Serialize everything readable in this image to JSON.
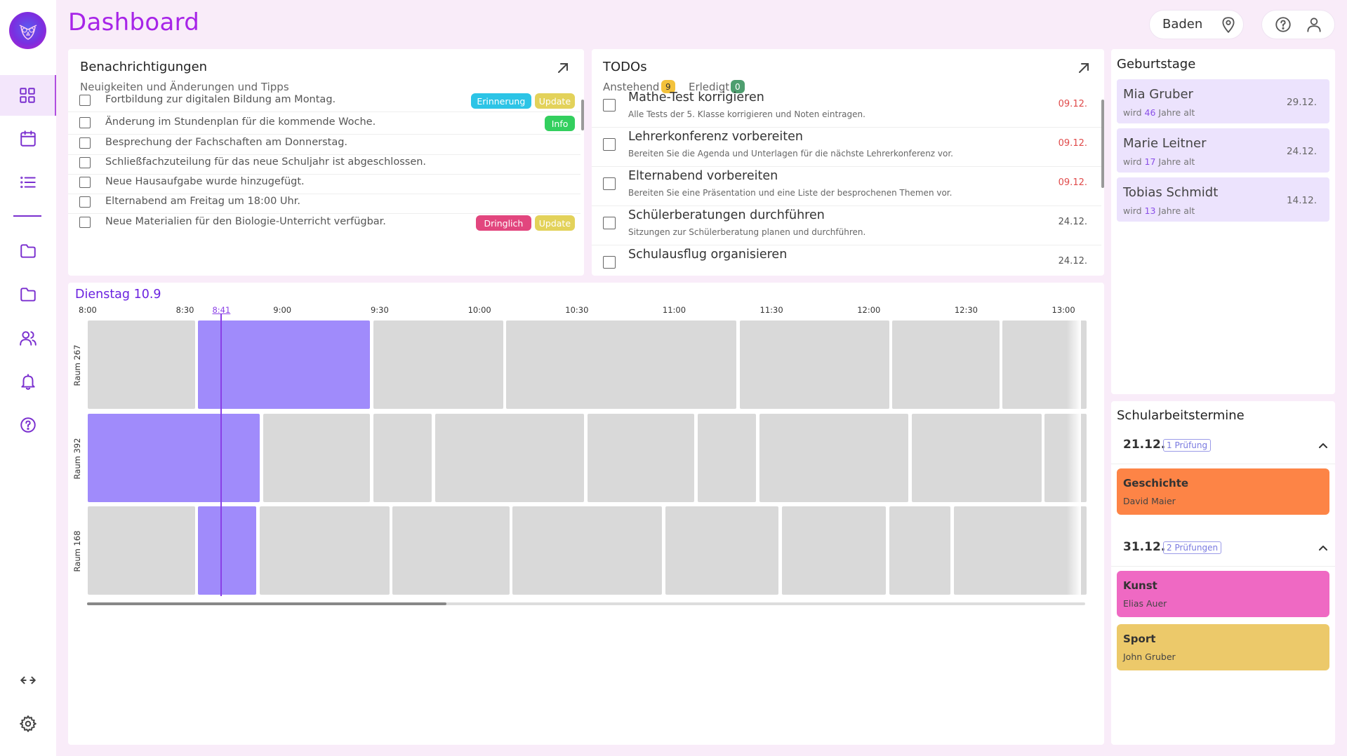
{
  "page": {
    "title": "Dashboard"
  },
  "header": {
    "location": "Baden"
  },
  "colors": {
    "accent": "#a724e8",
    "block_active": "#a08bfb",
    "block_idle": "#d9d9d9",
    "now_line": "#8a3fe6",
    "overdue": "#e04a4a"
  },
  "sidebar": {
    "items": [
      {
        "name": "dashboard",
        "icon": "grid-icon"
      },
      {
        "name": "calendar",
        "icon": "calendar-icon"
      },
      {
        "name": "list",
        "icon": "list-icon"
      },
      {
        "name": "folder-1",
        "icon": "folder-icon"
      },
      {
        "name": "folder-2",
        "icon": "folder-icon"
      },
      {
        "name": "users",
        "icon": "users-icon"
      },
      {
        "name": "notifications",
        "icon": "bell-icon"
      },
      {
        "name": "help",
        "icon": "help-icon"
      },
      {
        "name": "resize",
        "icon": "arrows-horizontal-icon"
      },
      {
        "name": "settings",
        "icon": "gear-icon"
      }
    ]
  },
  "notifications": {
    "title": "Benachrichtigungen",
    "subtitle": "Neuigkeiten und Änderungen und Tipps",
    "items": [
      {
        "text": "Fortbildung zur digitalen Bildung am Montag.",
        "badges": [
          {
            "label": "Erinnerung",
            "color": "#2cc4e6"
          },
          {
            "label": "Update",
            "color": "#e3d25a"
          }
        ]
      },
      {
        "text": "Änderung im Stundenplan für die kommende Woche.",
        "badges": [
          {
            "label": "Info",
            "color": "#33cf5e"
          }
        ]
      },
      {
        "text": "Besprechung der Fachschaften am Donnerstag.",
        "badges": []
      },
      {
        "text": "Schließfachzuteilung für das neue Schuljahr ist abgeschlossen.",
        "badges": []
      },
      {
        "text": "Neue Hausaufgabe wurde hinzugefügt.",
        "badges": []
      },
      {
        "text": "Elternabend am Freitag um 18:00 Uhr.",
        "badges": []
      },
      {
        "text": "Neue Materialien für den Biologie-Unterricht verfügbar.",
        "badges": [
          {
            "label": "Dringlich",
            "color": "#e2467e"
          },
          {
            "label": "Update",
            "color": "#e3d25a"
          }
        ]
      }
    ]
  },
  "todos": {
    "title": "TODOs",
    "pending_label": "Anstehend",
    "pending_count": "9",
    "done_label": "Erledigt",
    "done_count": "0",
    "items": [
      {
        "title": "Mathe-Test korrigieren",
        "desc": "Alle Tests der 5. Klasse korrigieren und Noten eintragen.",
        "date": "09.12.",
        "overdue": true
      },
      {
        "title": "Lehrerkonferenz vorbereiten",
        "desc": "Bereiten Sie die Agenda und Unterlagen für die nächste Lehrerkonferenz vor.",
        "date": "09.12.",
        "overdue": true
      },
      {
        "title": "Elternabend vorbereiten",
        "desc": "Bereiten Sie eine Präsentation und eine Liste der besprochenen Themen vor.",
        "date": "09.12.",
        "overdue": true
      },
      {
        "title": "Schülerberatungen durchführen",
        "desc": "Sitzungen zur Schülerberatung planen und durchführen.",
        "date": "24.12.",
        "overdue": false
      },
      {
        "title": "Schulausflug organisieren",
        "desc": "",
        "date": "24.12.",
        "overdue": false
      }
    ]
  },
  "birthdays": {
    "title": "Geburtstage",
    "items": [
      {
        "name": "Mia Gruber",
        "age_prefix": "wird",
        "age": "46",
        "age_suffix": "Jahre alt",
        "date": "29.12."
      },
      {
        "name": "Marie Leitner",
        "age_prefix": "wird",
        "age": "17",
        "age_suffix": "Jahre alt",
        "date": "24.12."
      },
      {
        "name": "Tobias Schmidt",
        "age_prefix": "wird",
        "age": "13",
        "age_suffix": "Jahre alt",
        "date": "14.12."
      }
    ]
  },
  "exams": {
    "title": "Schularbeitstermine",
    "groups": [
      {
        "date": "21.12.",
        "count_label": "1 Prüfung",
        "items": [
          {
            "subject": "Geschichte",
            "teacher": "David Maier",
            "color": "#fd8446"
          }
        ]
      },
      {
        "date": "31.12.",
        "count_label": "2 Prüfungen",
        "items": [
          {
            "subject": "Kunst",
            "teacher": "Elias Auer",
            "color": "#ef69c3"
          },
          {
            "subject": "Sport",
            "teacher": "John Gruber",
            "color": "#ecc96a"
          }
        ]
      }
    ]
  },
  "schedule": {
    "title": "Dienstag 10.9",
    "now_label": "8:41",
    "ticks": [
      "8:00",
      "8:30",
      "9:00",
      "9:30",
      "10:00",
      "10:30",
      "11:00",
      "11:30",
      "12:00",
      "12:30",
      "13:00"
    ],
    "rooms": [
      {
        "label": "Raum 267",
        "blocks": [
          {
            "start": "8:00",
            "end": "8:33",
            "active": false
          },
          {
            "start": "8:34",
            "end": "9:27",
            "active": true
          },
          {
            "start": "9:28",
            "end": "10:08",
            "active": false
          },
          {
            "start": "10:09",
            "end": "11:20",
            "active": false
          },
          {
            "start": "11:21",
            "end": "12:07",
            "active": false
          },
          {
            "start": "12:08",
            "end": "12:41",
            "active": false
          },
          {
            "start": "12:42",
            "end": "13:10",
            "active": false
          }
        ]
      },
      {
        "label": "Raum 392",
        "blocks": [
          {
            "start": "8:00",
            "end": "8:53",
            "active": true
          },
          {
            "start": "8:54",
            "end": "9:27",
            "active": false
          },
          {
            "start": "9:28",
            "end": "9:46",
            "active": false
          },
          {
            "start": "9:47",
            "end": "10:33",
            "active": false
          },
          {
            "start": "10:34",
            "end": "11:07",
            "active": false
          },
          {
            "start": "11:08",
            "end": "11:26",
            "active": false
          },
          {
            "start": "11:27",
            "end": "12:13",
            "active": false
          },
          {
            "start": "12:14",
            "end": "12:54",
            "active": false
          },
          {
            "start": "12:55",
            "end": "13:10",
            "active": false
          }
        ]
      },
      {
        "label": "Raum 168",
        "blocks": [
          {
            "start": "8:00",
            "end": "8:33",
            "active": false
          },
          {
            "start": "8:34",
            "end": "8:52",
            "active": true
          },
          {
            "start": "8:53",
            "end": "9:33",
            "active": false
          },
          {
            "start": "9:34",
            "end": "10:10",
            "active": false
          },
          {
            "start": "10:11",
            "end": "10:57",
            "active": false
          },
          {
            "start": "10:58",
            "end": "11:33",
            "active": false
          },
          {
            "start": "11:34",
            "end": "12:06",
            "active": false
          },
          {
            "start": "12:07",
            "end": "12:26",
            "active": false
          },
          {
            "start": "12:27",
            "end": "13:10",
            "active": false
          }
        ]
      }
    ],
    "scroll_fraction": 0.36
  }
}
